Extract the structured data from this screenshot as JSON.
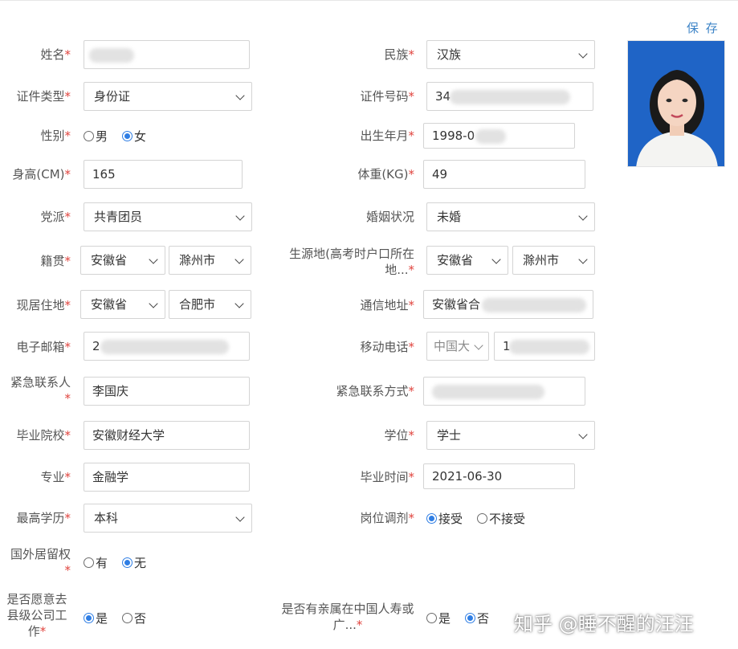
{
  "save_label": "保 存",
  "watermark": "知乎 @睡不醒的汪汪",
  "colors": {
    "required": "#e0433d",
    "link": "#3d84c7",
    "radio_selected": "#2f7ee4",
    "photo_bg": "#1f64c6"
  },
  "fields": {
    "name": {
      "label": "姓名",
      "req": "*",
      "value": ""
    },
    "ethnicity": {
      "label": "民族",
      "req": "*",
      "value": "汉族"
    },
    "id_type": {
      "label": "证件类型",
      "req": "*",
      "value": "身份证"
    },
    "id_number": {
      "label": "证件号码",
      "req": "*",
      "value": "34"
    },
    "gender": {
      "label": "性别",
      "req": "*",
      "options": [
        "男",
        "女"
      ],
      "selected": "女"
    },
    "birth": {
      "label": "出生年月",
      "req": "*",
      "value": "1998-0"
    },
    "height": {
      "label": "身高(CM)",
      "req": "*",
      "value": "165"
    },
    "weight": {
      "label": "体重(KG)",
      "req": "*",
      "value": "49"
    },
    "party": {
      "label": "党派",
      "req": "*",
      "value": "共青团员"
    },
    "marital": {
      "label": "婚姻状况",
      "value": "未婚"
    },
    "native_place": {
      "label": "籍贯",
      "req": "*",
      "province": "安徽省",
      "city": "滁州市"
    },
    "origin": {
      "label": "生源地(高考时户口所在地...",
      "req": "*",
      "province": "安徽省",
      "city": "滁州市"
    },
    "residence": {
      "label": "现居住地",
      "req": "*",
      "province": "安徽省",
      "city": "合肥市"
    },
    "address": {
      "label": "通信地址",
      "req": "*",
      "value": "安徽省合"
    },
    "email": {
      "label": "电子邮箱",
      "req": "*",
      "value": "2"
    },
    "mobile": {
      "label": "移动电话",
      "req": "*",
      "country": "中国大",
      "value": "1"
    },
    "emergency_contact": {
      "label": "紧急联系人",
      "req": "*",
      "value": "李国庆"
    },
    "emergency_phone": {
      "label": "紧急联系方式",
      "req": "*",
      "value": ""
    },
    "school": {
      "label": "毕业院校",
      "req": "*",
      "value": "安徽财经大学"
    },
    "degree": {
      "label": "学位",
      "req": "*",
      "value": "学士"
    },
    "major": {
      "label": "专业",
      "req": "*",
      "value": "金融学"
    },
    "grad_date": {
      "label": "毕业时间",
      "req": "*",
      "value": "2021-06-30"
    },
    "education": {
      "label": "最高学历",
      "req": "*",
      "value": "本科"
    },
    "adjust": {
      "label": "岗位调剂",
      "req": "*",
      "options": [
        "接受",
        "不接受"
      ],
      "selected": "接受"
    },
    "foreign_residence": {
      "label": "国外居留权",
      "req": "*",
      "options": [
        "有",
        "无"
      ],
      "selected": "无"
    },
    "county_work": {
      "label": "是否愿意去县级公司工作",
      "req": "*",
      "options": [
        "是",
        "否"
      ],
      "selected": "是"
    },
    "relatives": {
      "label": "是否有亲属在中国人寿或广...",
      "req": "*",
      "options": [
        "是",
        "否"
      ],
      "selected": "否"
    }
  }
}
